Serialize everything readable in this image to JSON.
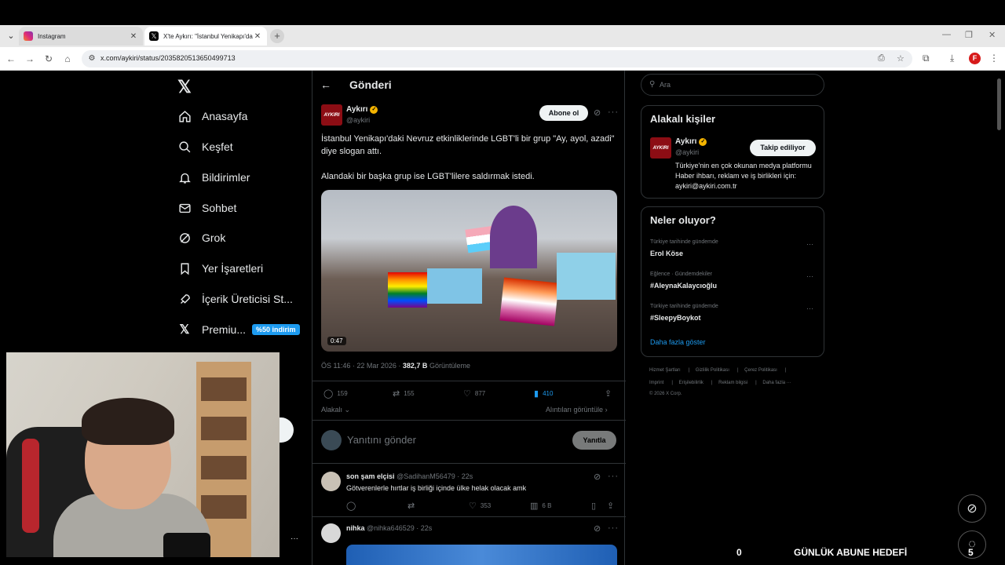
{
  "browser": {
    "tabs": [
      {
        "title": "Instagram",
        "favicon_color": "#e1306c"
      },
      {
        "title": "X'te Aykırı: \"İstanbul Yenikapı'da",
        "favicon_color": "#000000"
      }
    ],
    "url": "x.com/aykiri/status/2035820513650499713"
  },
  "sidebar": {
    "items": [
      {
        "label": "Anasayfa",
        "icon": "home-icon"
      },
      {
        "label": "Keşfet",
        "icon": "search-icon"
      },
      {
        "label": "Bildirimler",
        "icon": "bell-icon"
      },
      {
        "label": "Sohbet",
        "icon": "mail-icon"
      },
      {
        "label": "Grok",
        "icon": "grok-icon"
      },
      {
        "label": "Yer İşaretleri",
        "icon": "bookmark-icon"
      },
      {
        "label": "İçerik Üreticisi St...",
        "icon": "rocket-icon"
      },
      {
        "label": "Premiu...",
        "icon": "x-icon"
      }
    ],
    "premium_badge": "%50 indirim"
  },
  "post": {
    "header_title": "Gönderi",
    "author": {
      "name": "Aykırı",
      "handle": "@aykiri",
      "avatar_text": "AYKIRI"
    },
    "subscribe_label": "Abone ol",
    "text_p1": "İstanbul Yenikapı'daki Nevruz etkinliklerinde LGBT'li bir grup \"Ay, ayol, azadi\" diye slogan attı.",
    "text_p2": "Alandaki bir başka grup ise LGBT'lilere saldırmak istedi.",
    "video_duration": "0:47",
    "timestamp": "ÖS 11:46 · 22 Mar 2026 · ",
    "views": "382,7 B",
    "views_label": "Görüntüleme",
    "stats": {
      "replies": "159",
      "reposts": "155",
      "likes": "877",
      "bookmarks": "410"
    },
    "relevant_label": "Alakalı",
    "quotes_label": "Alıntıları görüntüle",
    "reply_placeholder": "Yanıtını gönder",
    "reply_button": "Yanıtla"
  },
  "comments": [
    {
      "name": "son şam elçisi",
      "handle": "@SadihanM56479 · 22s",
      "text": "Götverenlerle hırtlar iş birliği içinde ülke helak olacak amk",
      "likes": "353",
      "views": "6 B"
    },
    {
      "name": "nihka",
      "handle": "@nihka646529 · 22s"
    }
  ],
  "right": {
    "search_placeholder": "Ara",
    "related_title": "Alakalı kişiler",
    "related_person": {
      "name": "Aykırı",
      "handle": "@aykiri",
      "button": "Takip ediliyor",
      "bio": "Türkiye'nin en çok okunan medya platformu Haber ihbarı, reklam ve iş birlikleri için: aykiri@aykiri.com.tr"
    },
    "trends_title": "Neler oluyor?",
    "trends": [
      {
        "context": "Türkiye tarihinde gündemde",
        "name": "Erol Köse"
      },
      {
        "context": "Eğlence · Gündemdekiler",
        "name": "#AleynaKalaycıoğlu"
      },
      {
        "context": "Türkiye tarihinde gündemde",
        "name": "#SleepyBoykot"
      }
    ],
    "show_more": "Daha fazla göster",
    "footer_line1": [
      "Hizmet Şartları",
      "Gizlilik Politikası",
      "Çerez Politikası"
    ],
    "footer_line2": [
      "Imprint",
      "Erişilebilirlik",
      "Reklam bilgisi",
      "Daha fazla ···"
    ],
    "copyright": "© 2026 X Corp."
  },
  "overlay": {
    "goal_left": "0",
    "goal_label": "GÜNLÜK ABUNE HEDEFİ",
    "goal_right": "5"
  },
  "colors": {
    "accent": "#1d9bf0",
    "verified": "#f4b400",
    "brand_red": "#8c0d14"
  }
}
